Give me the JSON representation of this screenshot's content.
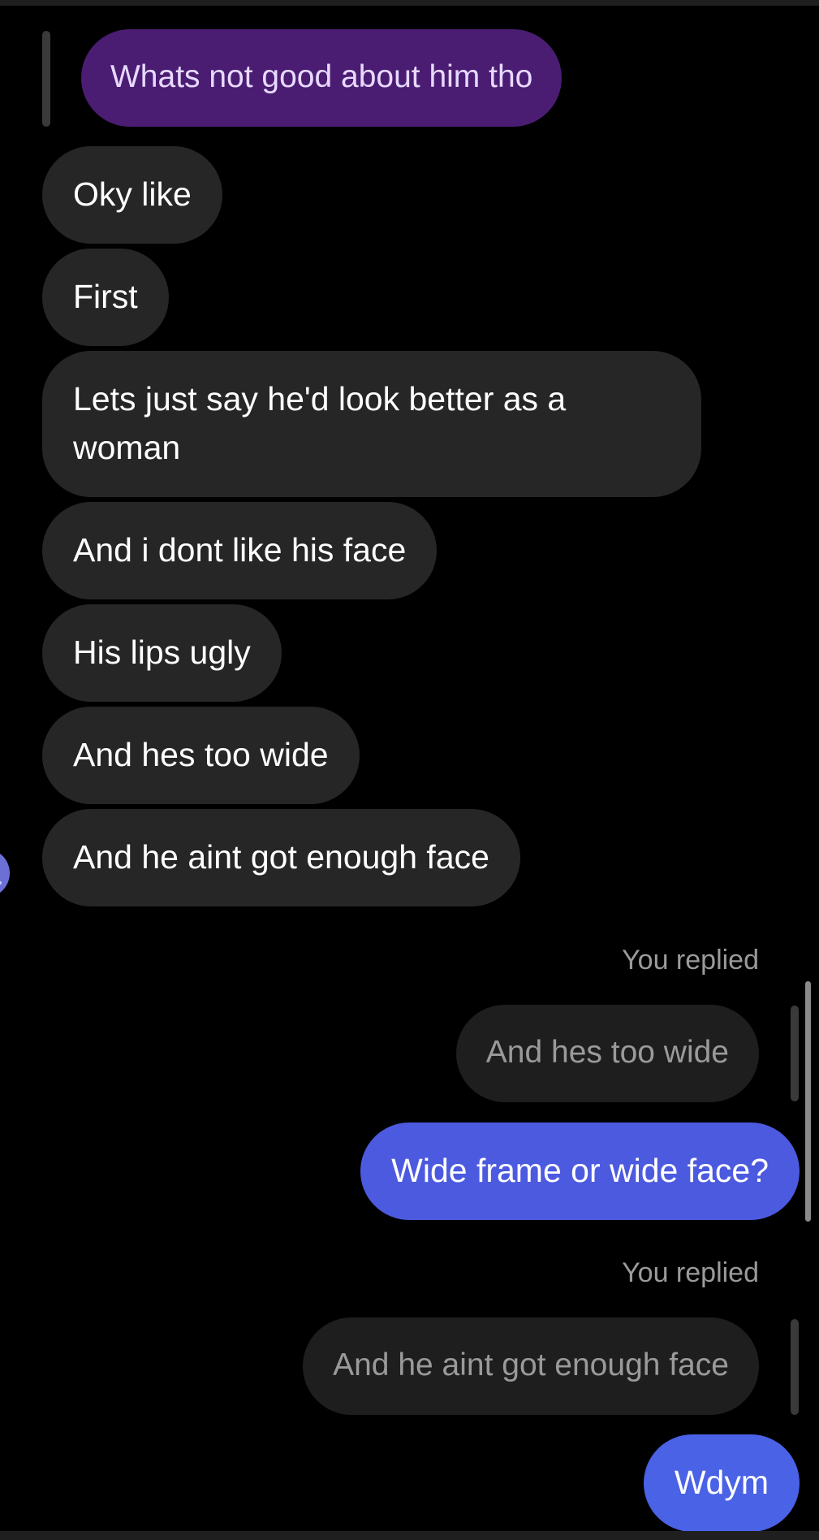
{
  "thread": {
    "quoted_message": "Whats not good about him tho",
    "incoming": [
      "Oky like",
      "First",
      "Lets just say he'd look better as a woman",
      "And i dont like his face",
      "His lips ugly",
      "And hes too wide",
      "And he aint got enough face"
    ],
    "replies": [
      {
        "label": "You replied",
        "quoted": "And hes too wide",
        "message": "Wide frame or wide face?"
      },
      {
        "label": "You replied",
        "quoted": "And he aint got enough face",
        "message": "Wdym"
      }
    ]
  },
  "colors": {
    "background": "#000000",
    "incoming_bubble": "#262626",
    "quoted_bubble": "#4a1d72",
    "outgoing_bubble": "#4c5ae0",
    "reply_quote_bubble": "#1e1e1e"
  },
  "icons": {
    "avatar": "sender-avatar-icon"
  }
}
